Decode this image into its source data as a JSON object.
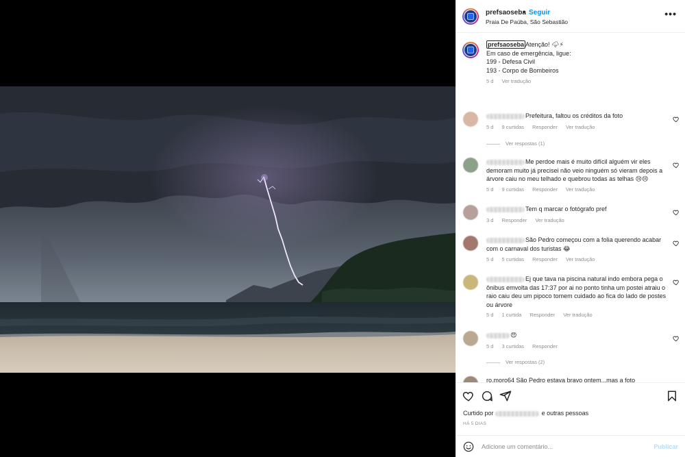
{
  "header": {
    "username": "prefsaoseba",
    "dot": "•",
    "follow_label": "Seguir",
    "location": "Praia De Paúba, São Sebastião",
    "more_icon": "more-horizontal-icon",
    "more_glyph": "•••"
  },
  "caption": {
    "username": "prefsaoseba",
    "lines": [
      "Atenção! 🌩⚡",
      "",
      "Em caso de emergência, ligue:",
      "",
      "199 - Defesa Civil",
      "193 - Corpo de Bombeiros"
    ],
    "time": "5 d",
    "translate": "Ver tradução"
  },
  "comments": [
    {
      "text": "Prefeitura, faltou os créditos da foto",
      "time": "5 d",
      "likes": "9 curtidas",
      "reply": "Responder",
      "translate": "Ver tradução",
      "view_replies": "Ver respostas (1)",
      "avatar_color": "#d9b7a7"
    },
    {
      "text": "Me perdoe mais é muito difícil alguém vir eles demoram muito já precisei não veio ninguém só vieram depois a árvore caiu no meu telhado e quebrou todas as telhas 😢😢",
      "time": "5 d",
      "likes": "9 curtidas",
      "reply": "Responder",
      "translate": "Ver tradução",
      "avatar_color": "#8da08a"
    },
    {
      "text": "Tem q marcar o fotógrafo pref",
      "time": "3 d",
      "likes": "",
      "reply": "Responder",
      "translate": "Ver tradução",
      "avatar_color": "#b7a09c"
    },
    {
      "text": "São Pedro começou com a folia querendo acabar com o carnaval dos turistas 😂",
      "time": "5 d",
      "likes": "5 curtidas",
      "reply": "Responder",
      "translate": "Ver tradução",
      "avatar_color": "#a2786e"
    },
    {
      "text": "Ej que tava na piscina natural indo embora pega o ônibus emvolta das 17:37 por ai no ponto tinha um postei atraiu o raio caiu deu um pipoco tomem cuidado ao fica do lado de postes ou árvore",
      "time": "5 d",
      "likes": "1 curtida",
      "reply": "Responder",
      "translate": "Ver tradução",
      "avatar_color": "#c8b67a"
    },
    {
      "text": "😍",
      "time": "5 d",
      "likes": "3 curtidas",
      "reply": "Responder",
      "translate": "",
      "view_replies": "Ver respostas (2)",
      "avatar_color": "#b8a990"
    },
    {
      "text": "ro.moro64 São Pedro estava bravo ontem...mas a foto",
      "time": "",
      "likes": "",
      "reply": "",
      "translate": "",
      "avatar_color": "#9a8a7a"
    }
  ],
  "actions": {
    "like_icon": "heart-icon",
    "comment_icon": "comment-icon",
    "share_icon": "share-icon",
    "save_icon": "bookmark-icon",
    "liked_prefix": "Curtido por",
    "liked_suffix": "e outras pessoas",
    "time_ago": "HÁ 5 DIAS"
  },
  "add_comment": {
    "placeholder": "Adicione um comentário...",
    "publish_label": "Publicar",
    "emoji_icon": "smiley-icon"
  },
  "colors": {
    "accent": "#0095f6",
    "publish_disabled": "#b2dffc",
    "muted": "#8e8e8e"
  }
}
